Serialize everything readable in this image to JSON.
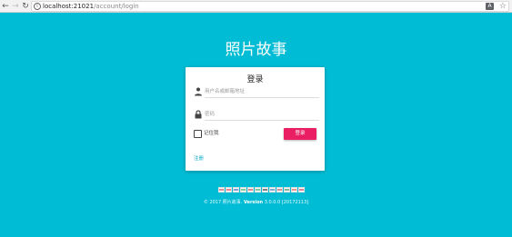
{
  "browser": {
    "url_host": "localhost:21021",
    "url_path": "/account/login"
  },
  "app_title": "照片故事",
  "login": {
    "title": "登录",
    "username_placeholder": "用户名或邮箱地址",
    "password_placeholder": "密码",
    "remember_label": "记住我",
    "login_button": "登录",
    "register_link": "注册"
  },
  "languages": [
    {
      "name": "English",
      "color": "#b22234"
    },
    {
      "name": "Türkçe",
      "color": "#e30a17"
    },
    {
      "name": "Русский",
      "color": "#0039a6"
    },
    {
      "name": "Português",
      "color": "#009c3b"
    },
    {
      "name": "Español",
      "color": "#c60b1e"
    },
    {
      "name": "Italiano",
      "color": "#009246"
    },
    {
      "name": "Deutsch",
      "color": "#000000"
    },
    {
      "name": "Français",
      "color": "#0055a4"
    },
    {
      "name": "Nederlands",
      "color": "#ae1c28"
    },
    {
      "name": "العربية",
      "color": "#006c35"
    },
    {
      "name": "简体中文",
      "color": "#de2910"
    },
    {
      "name": "日本語",
      "color": "#bc002d"
    }
  ],
  "footer": {
    "copyright": "© 2017 照片故事.",
    "version_label": "Version",
    "version": "3.0.0.0 [20172113]"
  }
}
